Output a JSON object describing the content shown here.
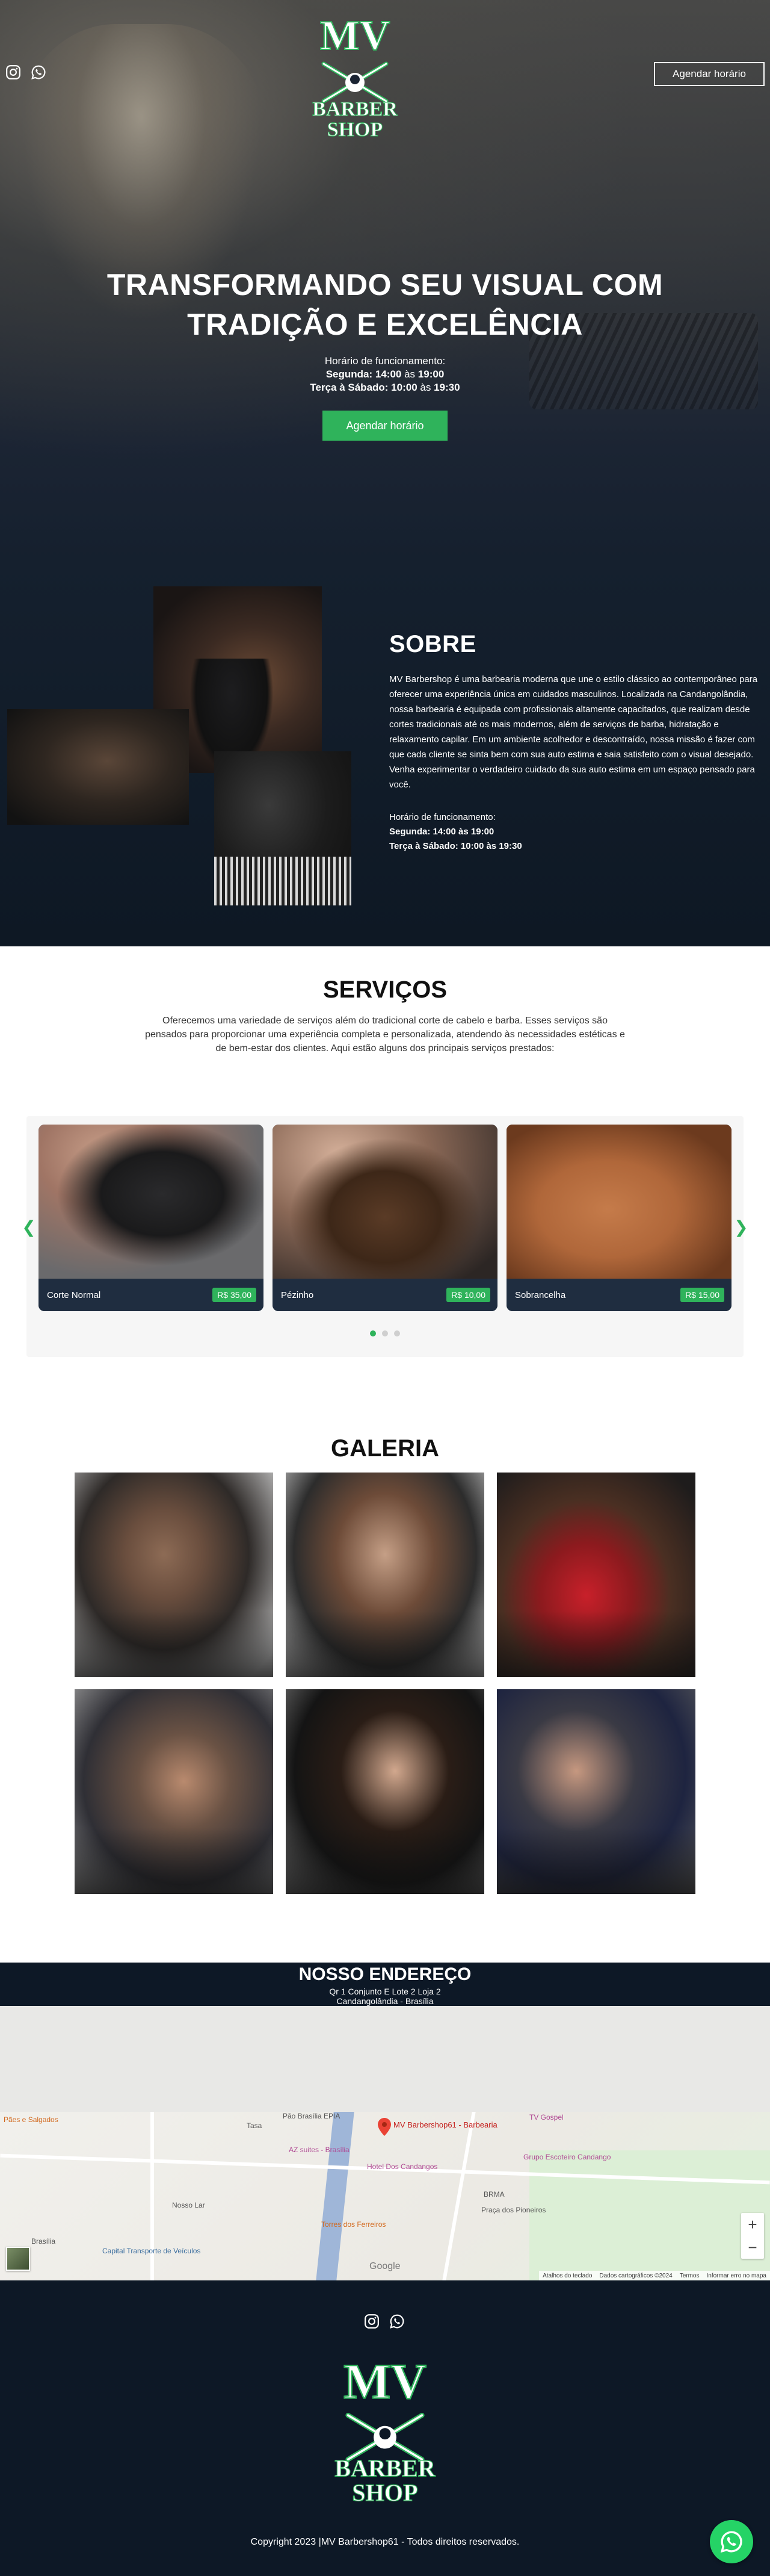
{
  "brand": {
    "logo_monogram": "MV",
    "logo_word1": "BARBER",
    "logo_word2": "SHOP"
  },
  "header": {
    "social_icons": [
      "instagram-icon",
      "whatsapp-icon"
    ],
    "cta_label": "Agendar horário"
  },
  "hero": {
    "title_line1": "TRANSFORMANDO SEU VISUAL COM",
    "title_line2": "TRADIÇÃO E EXCELÊNCIA",
    "hours_heading": "Horário de funcionamento:",
    "hours_line1_days": "Segunda: 14:00",
    "hours_line1_sep": "às",
    "hours_line1_end": "19:00",
    "hours_line2_days": "Terça à Sábado: 10:00",
    "hours_line2_sep": "às",
    "hours_line2_end": "19:30",
    "cta_label": "Agendar horário"
  },
  "sobre": {
    "title": "SOBRE",
    "text": "MV Barbershop é uma barbearia moderna que une o estilo clássico ao contemporâneo para oferecer uma experiência única em cuidados masculinos. Localizada na Candangolândia, nossa barbearia é equipada com profissionais altamente capacitados, que realizam desde cortes tradicionais até os mais modernos, além de serviços de barba, hidratação e relaxamento capilar. Em um ambiente acolhedor e descontraído, nossa missão é fazer com que cada cliente se sinta bem com sua auto estima e saia satisfeito com o visual desejado. Venha experimentar o verdadeiro cuidado da sua auto estima em um espaço pensado para você.",
    "hours_heading": "Horário de funcionamento:",
    "hours_line1": "Segunda: 14:00 às 19:00",
    "hours_line2": "Terça à Sábado: 10:00 às 19:30"
  },
  "servicos": {
    "title": "SERVIÇOS",
    "intro": "Oferecemos uma variedade de serviços além do tradicional corte de cabelo e barba. Esses serviços são pensados para proporcionar uma experiência completa e personalizada, atendendo às necessidades estéticas e de bem-estar dos clientes. Aqui estão alguns dos principais serviços prestados:",
    "prev_arrow": "❮",
    "next_arrow": "❯",
    "cards": [
      {
        "name": "Corte Normal",
        "price": "R$ 35,00"
      },
      {
        "name": "Pézinho",
        "price": "R$ 10,00"
      },
      {
        "name": "Sobrancelha",
        "price": "R$ 15,00"
      }
    ],
    "pagination": {
      "pages": 3,
      "active": 1
    }
  },
  "galeria": {
    "title": "GALERIA"
  },
  "endereco": {
    "title": "NOSSO ENDEREÇO",
    "line1": "Qr 1 Conjunto E Lote 2 Loja 2",
    "line2": "Candangolândia - Brasília"
  },
  "map": {
    "labels": {
      "pin": "MV Barbershop61 - Barbearia",
      "l1": "Pães e Salgados",
      "l2": "Tasa",
      "l3": "Pão Brasília EPIA",
      "l4": "TV Gospel",
      "l5": "AZ suites - Brasília",
      "l6": "Hotel Dos Candangos",
      "l7": "Grupo Escoteiro Candango",
      "l8": "Nosso Lar",
      "l9": "Torres dos Ferreiros",
      "l10": "BRMA",
      "l11": "Praça dos Pioneiros",
      "l12": "Capital Transporte de Veículos",
      "l13": "Brasília"
    },
    "zoom_in": "+",
    "zoom_out": "−",
    "google": "Google",
    "attrib": [
      "Atalhos do teclado",
      "Dados cartográficos ©2024",
      "Termos",
      "Informar erro no mapa"
    ]
  },
  "footer": {
    "social_icons": [
      "instagram-icon",
      "whatsapp-icon"
    ],
    "copyright": "Copyright 2023 |MV Barbershop61 - Todos direitos reservados."
  },
  "colors": {
    "accent_green": "#2fb35b",
    "navy": "#0d1826",
    "card_navy": "#1f2d40",
    "whatsapp": "#25d366"
  }
}
